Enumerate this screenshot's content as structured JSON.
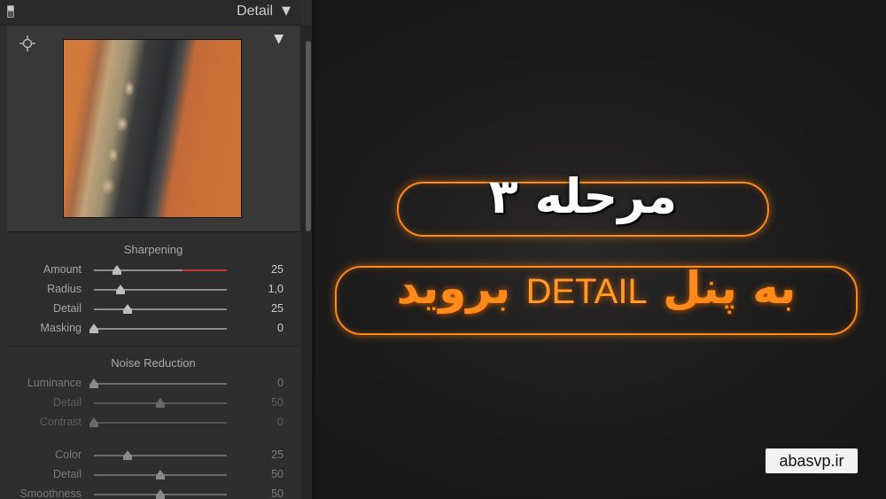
{
  "panel": {
    "title": "Detail",
    "collapse_icon": "triangle-down-icon",
    "preview": {
      "target_icon": "crosshair-target-icon",
      "menu_icon": "triangle-down-icon"
    },
    "sharpening": {
      "title": "Sharpening",
      "sliders": [
        {
          "label": "Amount",
          "value": "25",
          "level": 0.17
        },
        {
          "label": "Radius",
          "value": "1,0",
          "level": 0.2
        },
        {
          "label": "Detail",
          "value": "25",
          "level": 0.25
        },
        {
          "label": "Masking",
          "value": "0",
          "level": 0.0
        }
      ]
    },
    "noise_reduction": {
      "title": "Noise Reduction",
      "sliders": [
        {
          "label": "Luminance",
          "value": "0",
          "level": 0.0,
          "state": "mid"
        },
        {
          "label": "Detail",
          "value": "50",
          "level": 0.5,
          "state": "dim"
        },
        {
          "label": "Contrast",
          "value": "0",
          "level": 0.0,
          "state": "dim"
        },
        {
          "label": "Color",
          "value": "25",
          "level": 0.25,
          "state": "mid"
        },
        {
          "label": "Detail",
          "value": "50",
          "level": 0.5,
          "state": "mid"
        },
        {
          "label": "Smoothness",
          "value": "50",
          "level": 0.5,
          "state": "mid"
        }
      ]
    }
  },
  "promo": {
    "step_text": "مرحله ۳",
    "goto_prefix": "به پنل",
    "goto_keyword": "DETAIL",
    "goto_suffix": "بروید",
    "accent_color": "#ff8a1c"
  },
  "watermark": "abasvp.ir"
}
